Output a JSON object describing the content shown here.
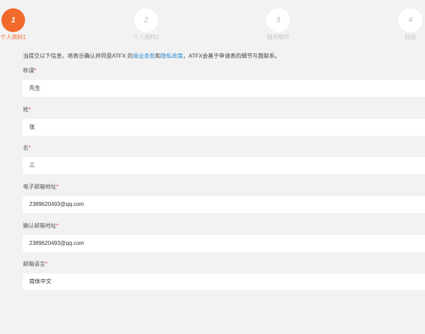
{
  "steps": [
    {
      "number": "1",
      "label": "个人资料1"
    },
    {
      "number": "2",
      "label": "个人资料2"
    },
    {
      "number": "3",
      "label": "财务细节"
    },
    {
      "number": "4",
      "label": "经验"
    }
  ],
  "intro": {
    "before": "当提交以下信息，将表示确认并同意ATFX 的",
    "link1": "商业条款",
    "middle": "和",
    "link2": "隐私政策",
    "after": "，ATFX会基于申请表的细节与我联系。"
  },
  "fields": {
    "title": {
      "label": "称谓",
      "required": "*",
      "value": "先生"
    },
    "surname": {
      "label": "姓",
      "required": "*",
      "value": "张"
    },
    "given_name": {
      "label": "名",
      "required": "*",
      "value": "三"
    },
    "email": {
      "label": "电子邮箱地址",
      "required": "*",
      "value": "2389620493@qq.com"
    },
    "confirm_email": {
      "label": "确认邮箱地址",
      "required": "*",
      "value": "2389620493@qq.com"
    },
    "email_language": {
      "label": "邮箱语言",
      "required": "*",
      "value": "简体中文"
    }
  },
  "colors": {
    "accent": "#f26a2b",
    "link": "#2a8cd6",
    "required": "#e53b2c",
    "background": "#f2f2f2"
  }
}
